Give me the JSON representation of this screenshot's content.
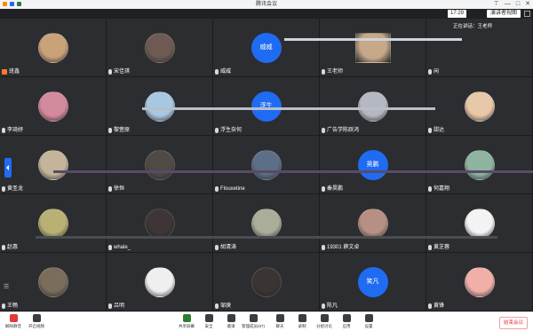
{
  "window": {
    "title": "腾讯会议"
  },
  "top": {
    "clock": "17:29",
    "speaker_view": "演讲者视图",
    "speaking_label": "正在讲话：王老师"
  },
  "participants": [
    {
      "name": "班鑫",
      "avatar": "photo",
      "color": "#c9a27a",
      "host": true
    },
    {
      "name": "宋佳琪",
      "avatar": "photo",
      "color": "#6e5a52"
    },
    {
      "name": "威威",
      "avatar": "text",
      "avatar_text": "威威"
    },
    {
      "name": "王老师",
      "avatar": "video",
      "color": "#c7a98a"
    },
    {
      "name": "闲",
      "avatar": "none"
    },
    {
      "name": "李琦妤",
      "avatar": "photo",
      "color": "#d48a9d"
    },
    {
      "name": "黎萱原",
      "avatar": "photo",
      "color": "#a7c8e0"
    },
    {
      "name": "浮生奈何",
      "avatar": "text",
      "avatar_text": "浮生"
    },
    {
      "name": "广告学陈跃鸿",
      "avatar": "photo",
      "color": "#b5b8c0"
    },
    {
      "name": "甜达",
      "avatar": "photo",
      "color": "#e6c7a8"
    },
    {
      "name": "黄圣龙",
      "avatar": "photo",
      "color": "#c4b59a"
    },
    {
      "name": "徐恒",
      "avatar": "photo",
      "color": "#4f4a46"
    },
    {
      "name": "Flouxetine",
      "avatar": "photo",
      "color": "#5b6f86"
    },
    {
      "name": "秦昊鹏",
      "avatar": "text",
      "avatar_text": "昊鹏"
    },
    {
      "name": "何嘉翔",
      "avatar": "photo",
      "color": "#8fb3a1"
    },
    {
      "name": "赵惠",
      "avatar": "photo",
      "color": "#b9b173"
    },
    {
      "name": "whale_",
      "avatar": "photo",
      "color": "#3d3536"
    },
    {
      "name": "胡清涛",
      "avatar": "photo",
      "color": "#a9ad9a"
    },
    {
      "name": "19301 薛文卓",
      "avatar": "photo",
      "color": "#b88f85"
    },
    {
      "name": "黄芝蓉",
      "avatar": "photo",
      "color": "#f3f3f3"
    },
    {
      "name": "王畅",
      "avatar": "photo",
      "color": "#7a6d5b"
    },
    {
      "name": "吕明",
      "avatar": "photo",
      "color": "#efefef"
    },
    {
      "name": "邹庚",
      "avatar": "photo",
      "color": "#3a3532"
    },
    {
      "name": "陈凡",
      "avatar": "text",
      "avatar_text": "笑凡"
    },
    {
      "name": "黄锋",
      "avatar": "photo",
      "color": "#f0b0a8"
    }
  ],
  "toolbar": {
    "buttons": [
      {
        "label": "解除静音",
        "icon": "microphone-icon"
      },
      {
        "label": "开启视频",
        "icon": "camera-icon"
      },
      {
        "label": "共享屏幕",
        "icon": "share-screen-icon"
      },
      {
        "label": "安全",
        "icon": "shield-icon"
      },
      {
        "label": "邀请",
        "icon": "invite-icon"
      },
      {
        "label": "管理成员(97)",
        "icon": "members-icon"
      },
      {
        "label": "聊天",
        "icon": "chat-icon"
      },
      {
        "label": "录制",
        "icon": "record-icon"
      },
      {
        "label": "分组讨论",
        "icon": "breakout-icon"
      },
      {
        "label": "应用",
        "icon": "apps-icon"
      },
      {
        "label": "设置",
        "icon": "settings-icon"
      }
    ],
    "end_meeting": "结束会议"
  }
}
